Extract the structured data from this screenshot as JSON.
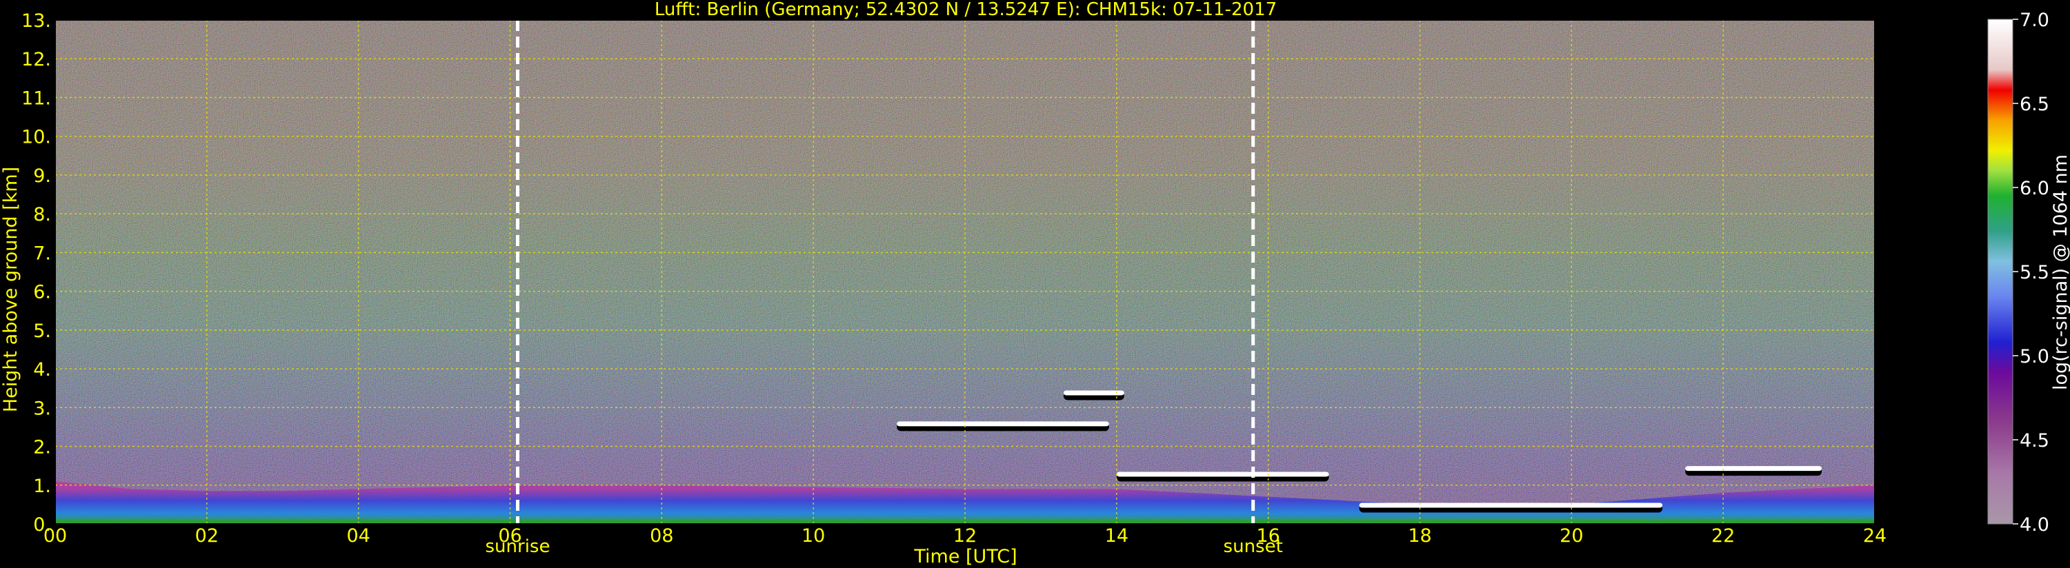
{
  "chart_data": {
    "type": "heatmap",
    "title": "Lufft: Berlin (Germany; 52.4302 N / 13.5247 E):    CHM15k: 07-11-2017",
    "xlabel": "Time [UTC]",
    "ylabel": "Height above ground [km]",
    "xlim": [
      0,
      24
    ],
    "ylim": [
      0,
      13
    ],
    "x_ticks": [
      "00",
      "02",
      "04",
      "06",
      "08",
      "10",
      "12",
      "14",
      "16",
      "18",
      "20",
      "22",
      "24"
    ],
    "y_ticks": [
      "0.",
      "1.",
      "2.",
      "3.",
      "4.",
      "5.",
      "6.",
      "7.",
      "8.",
      "9.",
      "10.",
      "11.",
      "12.",
      "13."
    ],
    "grid": true,
    "colorbar": {
      "label": "log(rc-signal) @ 1064 nm",
      "range": [
        4.0,
        7.0
      ],
      "ticks": [
        "4.0",
        "4.5",
        "5.0",
        "5.5",
        "6.0",
        "6.5",
        "7.0"
      ]
    },
    "markers": [
      {
        "label": "sunrise",
        "x": 6.1
      },
      {
        "label": "sunset",
        "x": 15.8
      }
    ],
    "cloud_layers": [
      {
        "x_start": 11.1,
        "x_end": 13.9,
        "height": 2.5
      },
      {
        "x_start": 13.3,
        "x_end": 14.1,
        "height": 3.3
      },
      {
        "x_start": 14.0,
        "x_end": 16.8,
        "height": 1.2
      },
      {
        "x_start": 17.2,
        "x_end": 21.2,
        "height": 0.4
      },
      {
        "x_start": 21.5,
        "x_end": 23.3,
        "height": 1.35
      }
    ],
    "boundary_layer_height": {
      "x": [
        0,
        1,
        2,
        3,
        4,
        5,
        6,
        8,
        10,
        12,
        14,
        16,
        18,
        20,
        22,
        24
      ],
      "y": [
        1.1,
        0.9,
        0.85,
        0.85,
        0.9,
        0.95,
        1.0,
        1.0,
        0.95,
        0.9,
        0.9,
        0.7,
        0.5,
        0.5,
        0.8,
        1.0
      ]
    }
  }
}
